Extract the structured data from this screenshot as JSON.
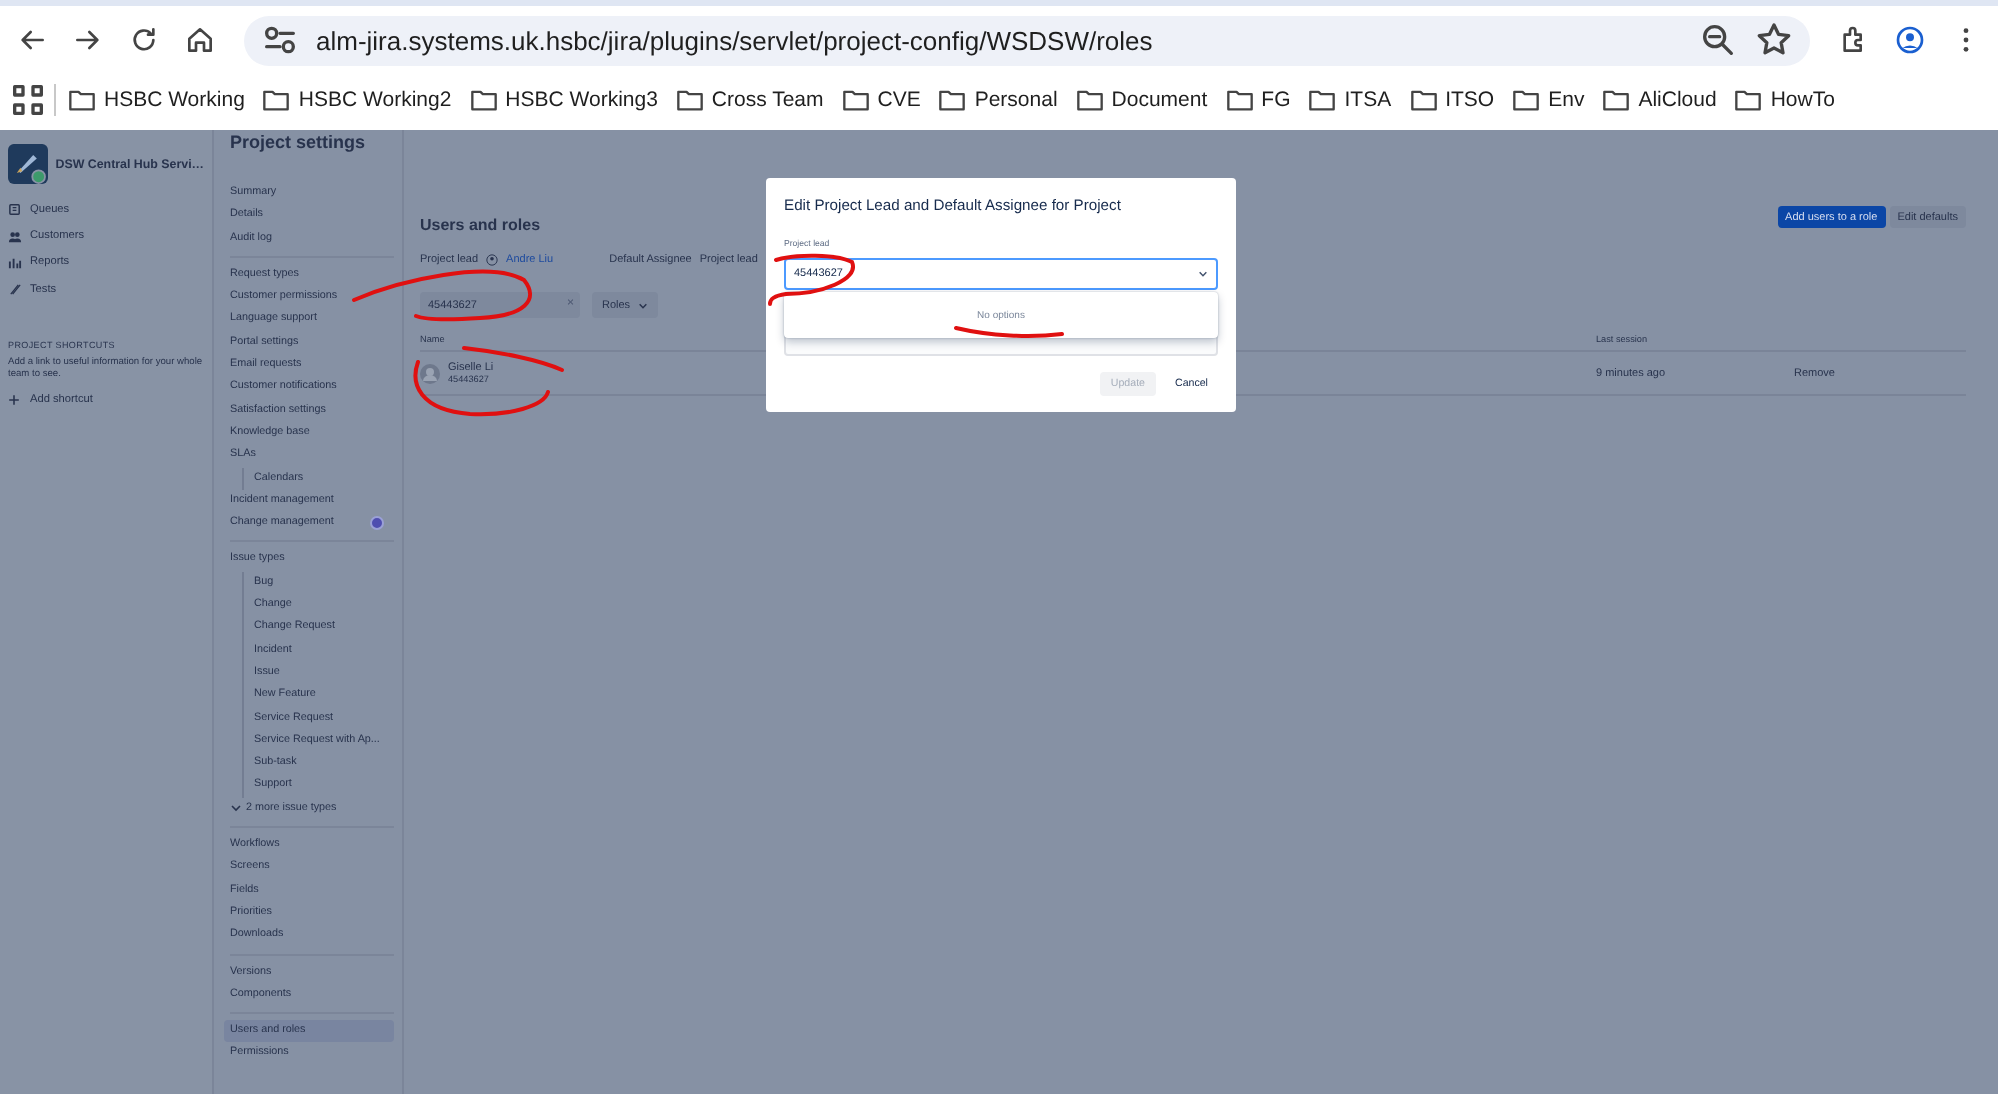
{
  "browser": {
    "url": "alm-jira.systems.uk.hsbc/jira/plugins/servlet/project-config/WSDSW/roles",
    "bookmarks": [
      "HSBC Working",
      "HSBC Working2",
      "HSBC Working3",
      "Cross Team",
      "CVE",
      "Personal",
      "Document",
      "FG",
      "ITSA",
      "ITSO",
      "Env",
      "AliCloud",
      "HowTo"
    ]
  },
  "sidebar": {
    "project_name": "DSW Central Hub Servi…",
    "items": [
      {
        "label": "Queues",
        "kind": "queues"
      },
      {
        "label": "Customers",
        "kind": "customers"
      },
      {
        "label": "Reports",
        "kind": "reports"
      },
      {
        "label": "Tests",
        "kind": "tests"
      }
    ],
    "shortcuts_heading": "PROJECT SHORTCUTS",
    "shortcuts_text": "Add a link to useful information for your whole team to see.",
    "add_shortcut": "Add shortcut"
  },
  "settings_nav": {
    "title": "Project settings",
    "groups": [
      [
        {
          "label": "Summary",
          "kind": "item",
          "selected": false
        },
        {
          "label": "Details",
          "kind": "item",
          "selected": false
        },
        {
          "label": "Audit log",
          "kind": "item",
          "selected": false
        }
      ],
      [
        {
          "label": "Request types",
          "kind": "item",
          "selected": false
        },
        {
          "label": "Customer permissions",
          "kind": "item",
          "selected": false
        },
        {
          "label": "Language support",
          "kind": "item",
          "selected": false
        },
        {
          "label": "Portal settings",
          "kind": "item",
          "selected": false
        },
        {
          "label": "Email requests",
          "kind": "item",
          "selected": false
        },
        {
          "label": "Customer notifications",
          "kind": "item",
          "selected": false
        },
        {
          "label": "Satisfaction settings",
          "kind": "item",
          "selected": false
        },
        {
          "label": "Knowledge base",
          "kind": "item",
          "selected": false
        },
        {
          "label": "SLAs",
          "kind": "item",
          "selected": false,
          "children": [
            {
              "label": "Calendars",
              "kind": "item",
              "selected": false
            }
          ]
        },
        {
          "label": "Incident management",
          "kind": "item",
          "selected": false
        },
        {
          "label": "Change management",
          "kind": "dot",
          "selected": false
        }
      ],
      [
        {
          "label": "Issue types",
          "kind": "item",
          "selected": false,
          "children": [
            {
              "label": "Bug",
              "kind": "item",
              "selected": false
            },
            {
              "label": "Change",
              "kind": "item",
              "selected": false
            },
            {
              "label": "Change Request",
              "kind": "item",
              "selected": false
            },
            {
              "label": "Incident",
              "kind": "item",
              "selected": false
            },
            {
              "label": "Issue",
              "kind": "item",
              "selected": false
            },
            {
              "label": "New Feature",
              "kind": "item",
              "selected": false
            },
            {
              "label": "Service Request",
              "kind": "item",
              "selected": false
            },
            {
              "label": "Service Request with Ap...",
              "kind": "item",
              "selected": false
            },
            {
              "label": "Sub-task",
              "kind": "item",
              "selected": false
            },
            {
              "label": "Support",
              "kind": "item",
              "selected": false
            }
          ]
        },
        {
          "label": "2 more issue types",
          "kind": "more",
          "selected": false
        }
      ],
      [
        {
          "label": "Workflows",
          "kind": "item",
          "selected": false
        },
        {
          "label": "Screens",
          "kind": "item",
          "selected": false
        },
        {
          "label": "Fields",
          "kind": "item",
          "selected": false
        },
        {
          "label": "Priorities",
          "kind": "item",
          "selected": false
        },
        {
          "label": "Downloads",
          "kind": "item",
          "selected": false
        }
      ],
      [
        {
          "label": "Versions",
          "kind": "item",
          "selected": false
        },
        {
          "label": "Components",
          "kind": "item",
          "selected": false
        }
      ],
      [
        {
          "label": "Users and roles",
          "kind": "item",
          "selected": true
        },
        {
          "label": "Permissions",
          "kind": "item",
          "selected": false
        }
      ]
    ]
  },
  "main": {
    "title": "Users and roles",
    "buttons": [
      {
        "label": "Add users to a role",
        "primary": true
      },
      {
        "label": "Edit defaults",
        "primary": false
      }
    ],
    "project_lead_label": "Project lead",
    "project_lead": "Andre Liu",
    "default_assignee_label": "Default Assignee",
    "default_assignee": "Project lead",
    "search": {
      "value": "45443627",
      "clear": "×"
    },
    "roles_filter": "Roles",
    "table": {
      "columns": [
        "Name",
        "Last session"
      ],
      "rows": [
        {
          "name": "Giselle Li",
          "id": "45443627",
          "last_session": "9 minutes ago",
          "action": "Remove"
        }
      ]
    }
  },
  "dialog": {
    "title": "Edit Project Lead and Default Assignee for Project",
    "field_label": "Project lead",
    "field_value": "45443627",
    "menu_message": "No options",
    "buttons": [
      {
        "label": "Update",
        "disabled": true
      },
      {
        "label": "Cancel",
        "disabled": false
      }
    ]
  }
}
